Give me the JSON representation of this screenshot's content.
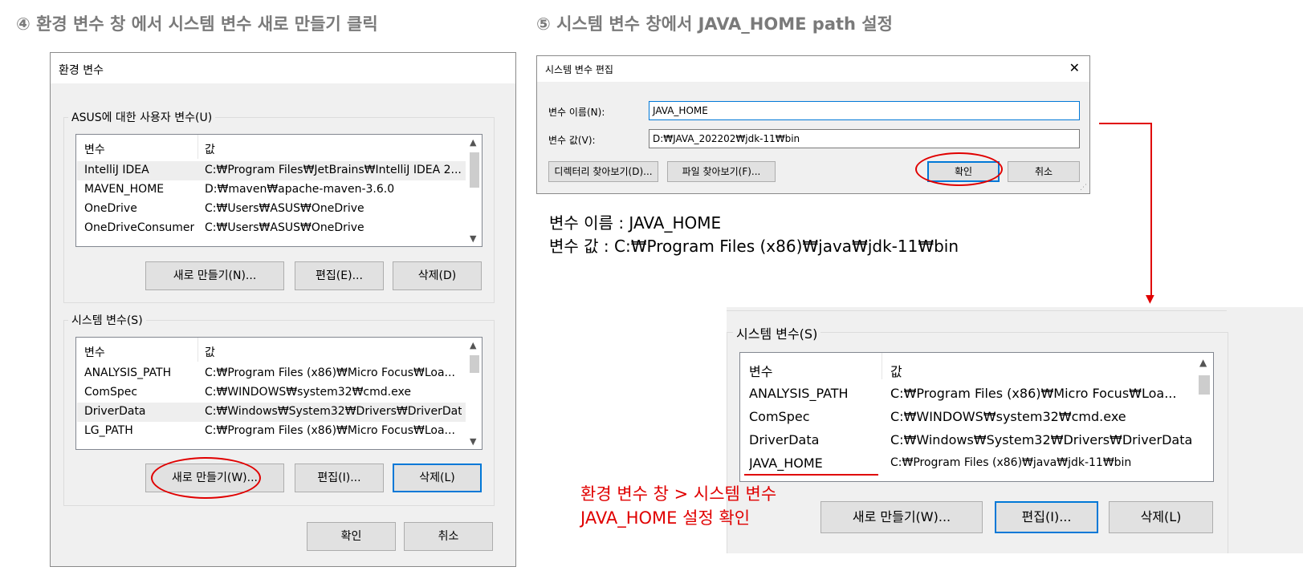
{
  "headings": {
    "step4": "④ 환경 변수 창 에서 시스템 변수 새로 만들기 클릭",
    "step5": "⑤ 시스템 변수 창에서 JAVA_HOME path 설정"
  },
  "env_dialog": {
    "title": "환경 변수",
    "user_group_label": "ASUS에 대한 사용자 변수(U)",
    "col_var": "변수",
    "col_val": "값",
    "user_vars": [
      {
        "name": "IntelliJ IDEA",
        "value": "C:₩Program Files₩JetBrains₩IntelliJ IDEA 2..."
      },
      {
        "name": "MAVEN_HOME",
        "value": "D:₩maven₩apache-maven-3.6.0"
      },
      {
        "name": "OneDrive",
        "value": "C:₩Users₩ASUS₩OneDrive"
      },
      {
        "name": "OneDriveConsumer",
        "value": "C:₩Users₩ASUS₩OneDrive"
      }
    ],
    "user_buttons": {
      "new": "새로 만들기(N)...",
      "edit": "편집(E)...",
      "delete": "삭제(D)"
    },
    "system_group_label": "시스템 변수(S)",
    "system_vars": [
      {
        "name": "ANALYSIS_PATH",
        "value": "C:₩Program Files (x86)₩Micro Focus₩Loa..."
      },
      {
        "name": "ComSpec",
        "value": "C:₩WINDOWS₩system32₩cmd.exe"
      },
      {
        "name": "DriverData",
        "value": "C:₩Windows₩System32₩Drivers₩DriverData"
      },
      {
        "name": "LG_PATH",
        "value": "C:₩Program Files (x86)₩Micro Focus₩Loa..."
      }
    ],
    "system_buttons": {
      "new": "새로 만들기(W)...",
      "edit": "편집(I)...",
      "delete": "삭제(L)"
    },
    "ok": "확인",
    "cancel": "취소"
  },
  "edit_dialog": {
    "title": "시스템 변수 편집",
    "close": "✕",
    "name_label": "변수 이름(N):",
    "name_value": "JAVA_HOME",
    "value_label": "변수 값(V):",
    "value_value": "D:₩JAVA_202202₩jdk-11₩bin",
    "browse_dir": "디렉터리 찾아보기(D)...",
    "browse_file": "파일 찾아보기(F)...",
    "ok": "확인",
    "cancel": "취소"
  },
  "note": {
    "line1": "변수 이름 : JAVA_HOME",
    "line2": "변수 값 : C:₩Program Files (x86)₩java₩jdk-11₩bin"
  },
  "result_panel": {
    "group_label": "시스템 변수(S)",
    "col_var": "변수",
    "col_val": "값",
    "vars": [
      {
        "name": "ANALYSIS_PATH",
        "value": "C:₩Program Files (x86)₩Micro Focus₩Loa..."
      },
      {
        "name": "ComSpec",
        "value": "C:₩WINDOWS₩system32₩cmd.exe"
      },
      {
        "name": "DriverData",
        "value": "C:₩Windows₩System32₩Drivers₩DriverData"
      },
      {
        "name": "JAVA_HOME",
        "value": "C:₩Program Files (x86)₩java₩jdk-11₩bin"
      }
    ],
    "buttons": {
      "new": "새로 만들기(W)...",
      "edit": "편집(I)...",
      "delete": "삭제(L)"
    }
  },
  "annotation": {
    "line1": "환경 변수 창 > 시스템 변수",
    "line2": "JAVA_HOME 설정 확인"
  },
  "colors": {
    "annotation_red": "#e00000",
    "focus_blue": "#0078d7"
  }
}
